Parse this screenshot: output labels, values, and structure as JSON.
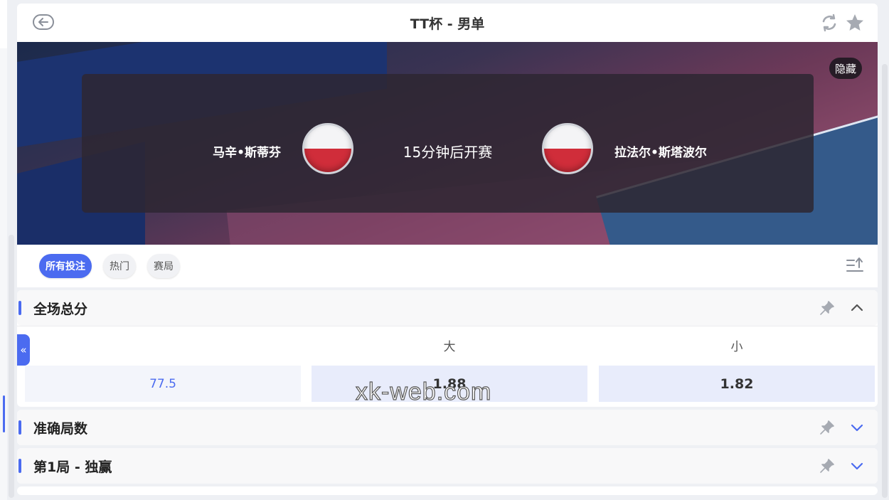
{
  "header": {
    "title": "TT杯 - 男单",
    "back_icon": "back-arrow-icon",
    "refresh_icon": "refresh-icon",
    "favorite_icon": "star-icon"
  },
  "banner": {
    "hide_label": "隐藏",
    "home_player": "马辛•斯蒂芬",
    "away_player": "拉法尔•斯塔波尔",
    "status": "15分钟后开赛",
    "home_flag": "poland-flag",
    "away_flag": "poland-flag"
  },
  "tabs": [
    {
      "label": "所有投注",
      "active": true
    },
    {
      "label": "热门",
      "active": false
    },
    {
      "label": "赛局",
      "active": false
    }
  ],
  "markets": {
    "total": {
      "title": "全场总分",
      "columns": [
        "大",
        "小"
      ],
      "line": "77.5",
      "over": "1.88",
      "under": "1.82",
      "expanded": true
    },
    "exact_games": {
      "title": "准确局数",
      "expanded": false
    },
    "game1_winner": {
      "title": "第1局 - 独赢",
      "expanded": false
    }
  },
  "side_toggle": "«",
  "watermark": "xk-web.com",
  "colors": {
    "accent": "#4b6bf0",
    "flag_red": "#d02d3a"
  }
}
